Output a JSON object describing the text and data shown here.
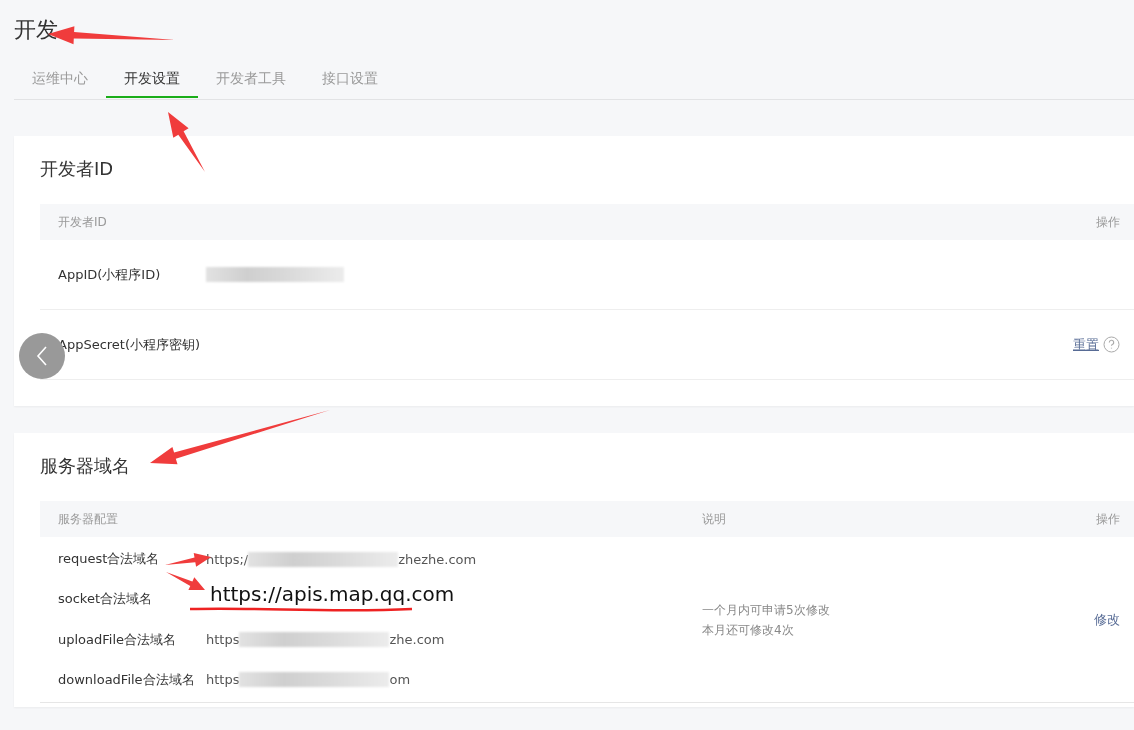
{
  "page": {
    "title": "开发"
  },
  "tabs": [
    {
      "label": "运维中心",
      "selected": false
    },
    {
      "label": "开发设置",
      "selected": true
    },
    {
      "label": "开发者工具",
      "selected": false
    },
    {
      "label": "接口设置",
      "selected": false
    }
  ],
  "developer_id": {
    "title": "开发者ID",
    "columns": [
      "开发者ID",
      "操作"
    ],
    "rows": [
      {
        "label": "AppID(小程序ID)",
        "redacted": true
      },
      {
        "label": "AppSecret(小程序密钥)",
        "action": "重置"
      }
    ]
  },
  "server_domains": {
    "title": "服务器域名",
    "columns": [
      "服务器配置",
      "说明",
      "操作"
    ],
    "rows": [
      {
        "label": "request合法域名",
        "value_start": "https;/",
        "value_end": "zhezhe.com"
      },
      {
        "label": "socket合法域名"
      },
      {
        "label": "uploadFile合法域名",
        "value_start": "https",
        "value_end": "zhe.com"
      },
      {
        "label": "downloadFile合法域名",
        "value_start": "https",
        "value_end": "om"
      }
    ],
    "notes": [
      "一个月内可申请5次修改",
      "本月还可修改4次"
    ],
    "action": "修改"
  },
  "annotation": {
    "text": "https://apis.map.qq.com"
  }
}
